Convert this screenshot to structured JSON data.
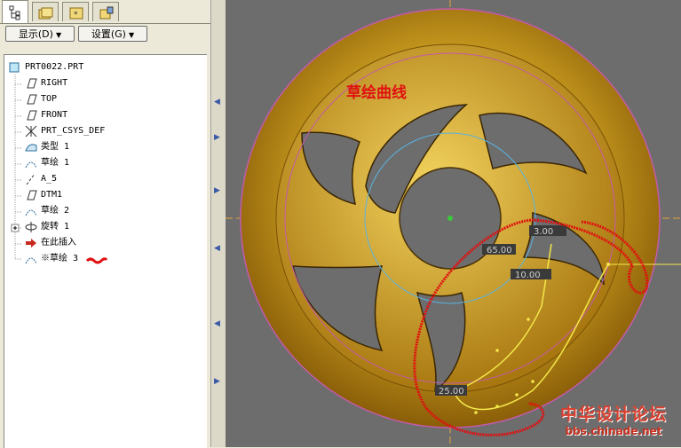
{
  "toolbar": {
    "show_label": "显示(D)",
    "settings_label": "设置(G)"
  },
  "tree": {
    "root": "PRT0022.PRT",
    "items": [
      {
        "label": "RIGHT",
        "icon": "datum-plane-icon"
      },
      {
        "label": "TOP",
        "icon": "datum-plane-icon"
      },
      {
        "label": "FRONT",
        "icon": "datum-plane-icon"
      },
      {
        "label": "PRT_CSYS_DEF",
        "icon": "coordinate-system-icon"
      },
      {
        "label": "类型 1",
        "icon": "surface-feature-icon"
      },
      {
        "label": "草绘 1",
        "icon": "sketch-icon"
      },
      {
        "label": "A_5",
        "icon": "datum-axis-icon"
      },
      {
        "label": "DTM1",
        "icon": "datum-plane-icon"
      },
      {
        "label": "草绘 2",
        "icon": "sketch-icon"
      },
      {
        "label": "旋转 1",
        "icon": "revolve-icon"
      },
      {
        "label": "在此插入",
        "icon": "insert-here-arrow-icon"
      },
      {
        "label": "※草绘 3",
        "icon": "sketch-icon"
      }
    ]
  },
  "viewport": {
    "annotation": "草绘曲线",
    "dimensions": [
      "65.00",
      "10.00",
      "25.00",
      "3.00"
    ],
    "watermark": {
      "title": "中华设计论坛",
      "url": "bbs.chinade.net"
    }
  },
  "colors": {
    "model_gold": "#c49a1c",
    "background": "#6d6d6d",
    "annotation_red": "#e01010",
    "datum_orange": "#e8a43c"
  }
}
